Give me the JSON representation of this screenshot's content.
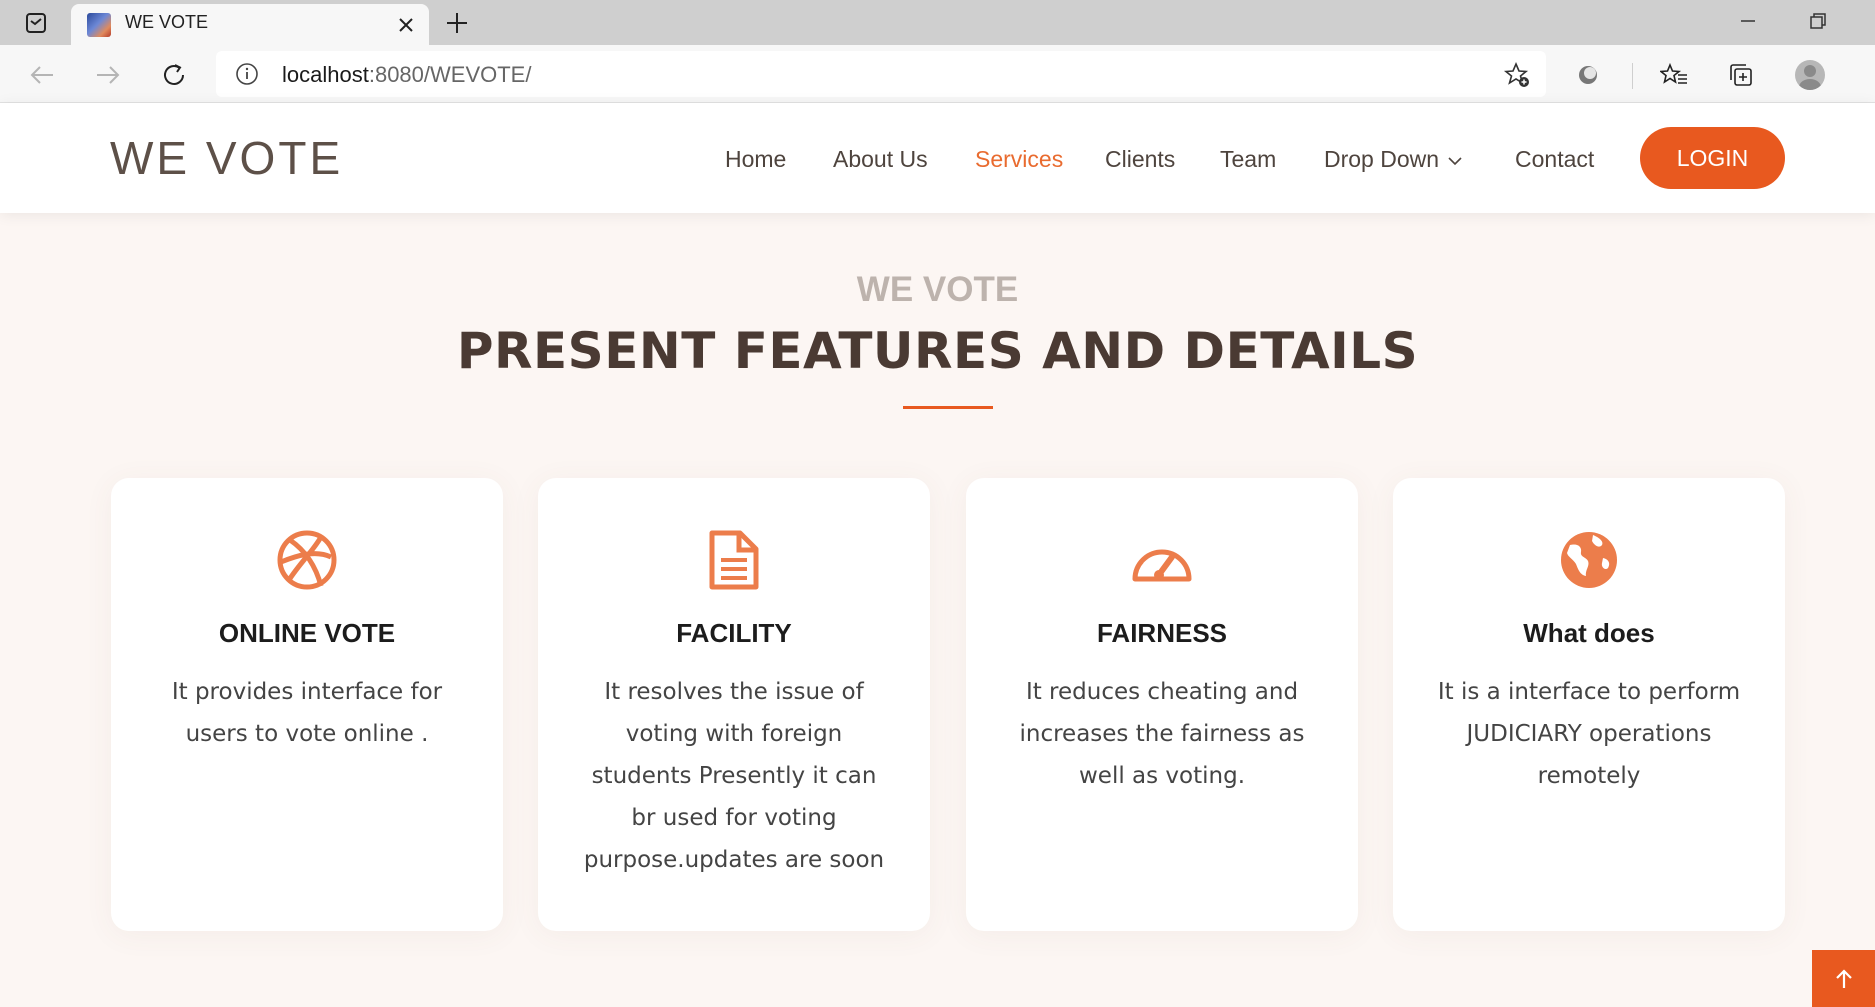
{
  "browser": {
    "tab_title": "WE VOTE",
    "url_host": "localhost",
    "url_rest": ":8080/WEVOTE/"
  },
  "header": {
    "logo": "WE VOTE",
    "nav": [
      "Home",
      "About Us",
      "Services",
      "Clients",
      "Team",
      "Drop Down",
      "Contact"
    ],
    "active_nav": "Services",
    "login_label": "LOGIN"
  },
  "section": {
    "subtitle": "WE VOTE",
    "title": "PRESENT FEATURES AND DETAILS"
  },
  "cards": [
    {
      "icon": "dribbble-icon",
      "title": "ONLINE VOTE",
      "desc": "It provides interface for users to vote online ."
    },
    {
      "icon": "document-icon",
      "title": "FACILITY",
      "desc": "It resolves the issue of voting with foreign students Presently it can br used for voting purpose.updates are soon"
    },
    {
      "icon": "speedometer-icon",
      "title": "FAIRNESS",
      "desc": "It reduces cheating and increases the fairness as well as voting."
    },
    {
      "icon": "globe-icon",
      "title": "What does",
      "desc": "It is a interface to perform JUDICIARY operations remotely"
    }
  ],
  "colors": {
    "accent": "#e8591f",
    "icon": "#ec7d4b",
    "heading": "#4a3a33",
    "background": "#fcf6f3"
  }
}
